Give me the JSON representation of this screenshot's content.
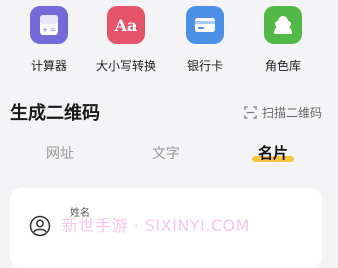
{
  "apps": [
    {
      "label": "计算器",
      "icon": "calculator-icon",
      "color": "#7469d8"
    },
    {
      "label": "大小写转换",
      "icon": "case-convert-icon",
      "color": "#e5546a"
    },
    {
      "label": "银行卡",
      "icon": "bank-card-icon",
      "color": "#4b8fe6"
    },
    {
      "label": "角色库",
      "icon": "character-library-icon",
      "color": "#52b948"
    }
  ],
  "case_icon_text": "Aa",
  "section": {
    "title": "生成二维码",
    "scan_label": "扫描二维码"
  },
  "tabs": [
    {
      "label": "网址"
    },
    {
      "label": "文字"
    },
    {
      "label": "名片",
      "active": true
    }
  ],
  "form": {
    "name_label": "姓名",
    "watermark": "新世手游 · SIXINYI.COM"
  },
  "colors": {
    "accent": "#f5c443",
    "background": "#f4f4f6"
  }
}
